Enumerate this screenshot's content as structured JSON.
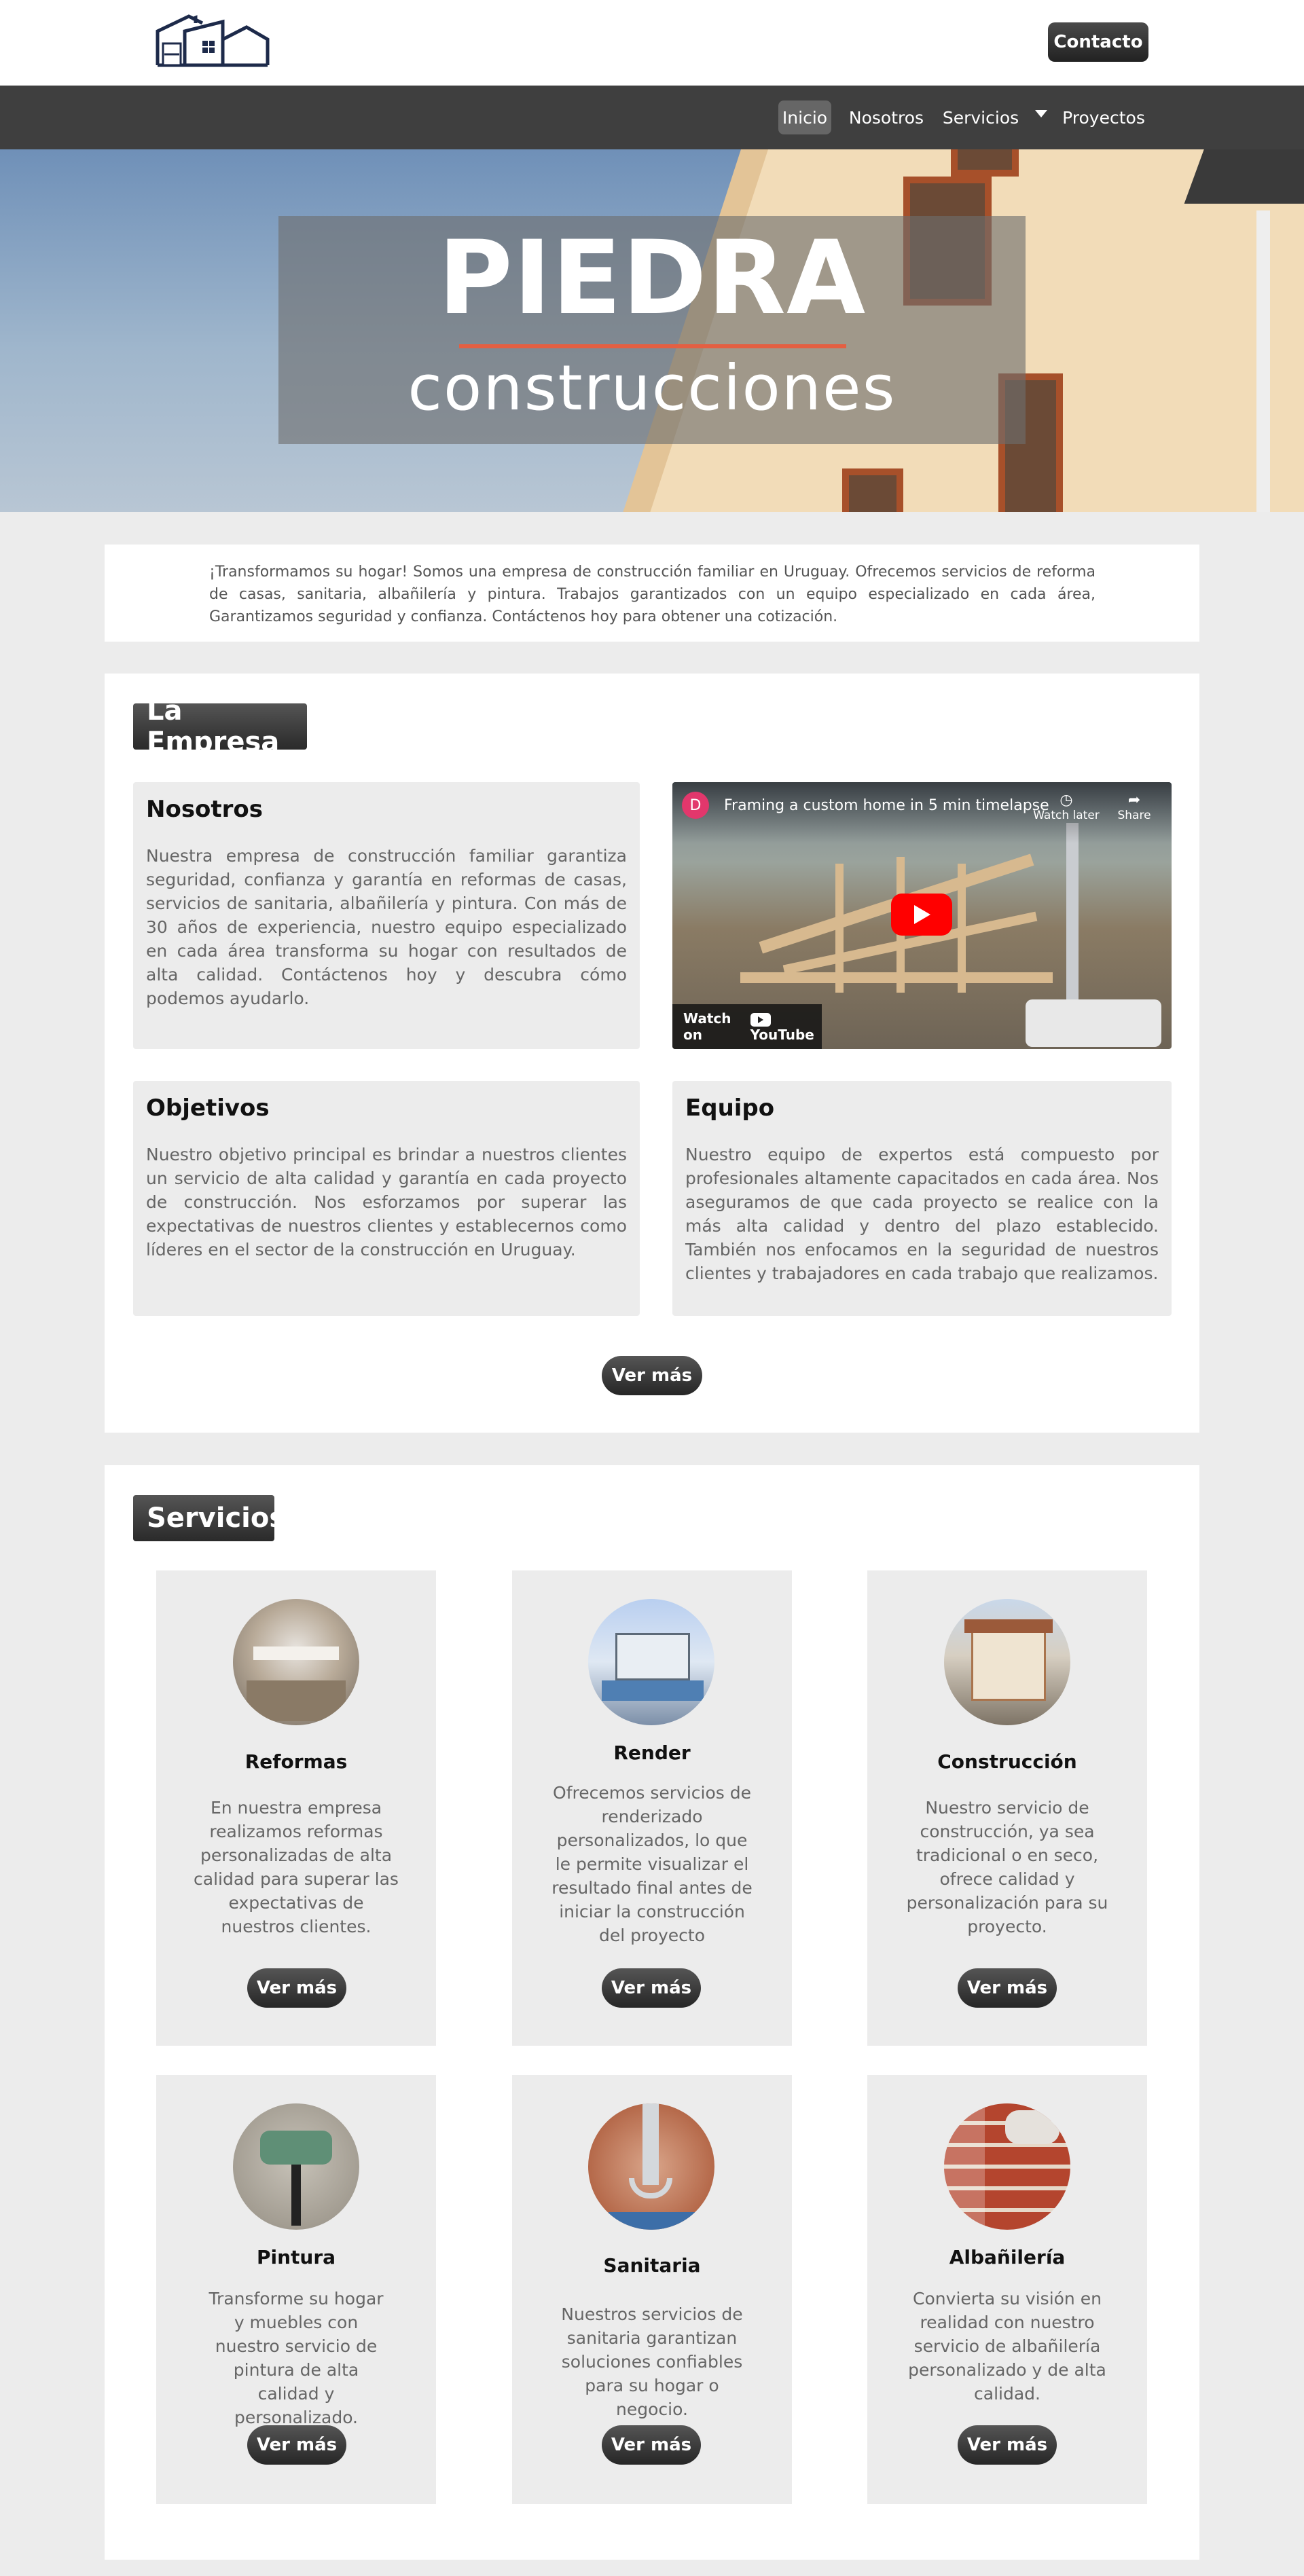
{
  "header": {
    "contact_label": "Contacto"
  },
  "nav": {
    "items": [
      "Inicio",
      "Nosotros",
      "Servicios",
      "Proyectos"
    ]
  },
  "hero": {
    "title": "PIEDRA",
    "subtitle": "construcciones"
  },
  "intro": {
    "text": "¡Transformamos su hogar! Somos una empresa de construcción familiar en Uruguay. Ofrecemos servicios de reforma de casas, sanitaria, albañilería y pintura. Trabajos garantizados con un equipo especializado en cada área, Garantizamos seguridad y confianza. Contáctenos hoy para obtener una cotización."
  },
  "empresa": {
    "heading": "La Empresa",
    "nosotros": {
      "title": "Nosotros",
      "text": "Nuestra empresa de construcción familiar garantiza seguridad, confianza y garantía en reformas de casas, servicios de sanitaria, albañilería y pintura. Con más de 30 años de experiencia, nuestro equipo especializado en cada área transforma su hogar con resultados de alta calidad. Contáctenos hoy y descubra cómo podemos ayudarlo."
    },
    "objetivos": {
      "title": "Objetivos",
      "text": "Nuestro objetivo principal es brindar a nuestros clientes un servicio de alta calidad y garantía en cada proyecto de construcción. Nos esforzamos por superar las expectativas de nuestros clientes y establecernos como líderes en el sector de la construcción en Uruguay."
    },
    "equipo": {
      "title": "Equipo",
      "text": "Nuestro equipo de expertos está compuesto por profesionales altamente capacitados en cada área. Nos aseguramos de que cada proyecto se realice con la más alta calidad y dentro del plazo establecido. También nos enfocamos en la seguridad de nuestros clientes y trabajadores en cada trabajo que realizamos."
    },
    "video": {
      "avatar": "D",
      "title": "Framing a custom home in 5 min timelapse",
      "watch_later": "Watch later",
      "share": "Share",
      "watch_on": "Watch on",
      "youtube": "YouTube"
    },
    "more_label": "Ver más"
  },
  "servicios": {
    "heading": "Servicios",
    "more_label": "Ver más",
    "items": [
      {
        "title": "Reformas",
        "text": "En nuestra empresa realizamos reformas personalizadas de alta calidad para superar las expectativas de nuestros clientes."
      },
      {
        "title": "Render",
        "text": "Ofrecemos servicios de renderizado personalizados, lo que le permite visualizar el resultado final antes de iniciar la construcción del proyecto"
      },
      {
        "title": "Construcción",
        "text": "Nuestro servicio de construcción, ya sea tradicional o en seco, ofrece calidad y personalización para su proyecto."
      },
      {
        "title": "Pintura",
        "text": "Transforme su hogar y muebles con nuestro servicio de pintura de alta calidad y personalizado."
      },
      {
        "title": "Sanitaria",
        "text": "Nuestros servicios de sanitaria garantizan soluciones confiables para su hogar o negocio."
      },
      {
        "title": "Albañilería",
        "text": "Convierta su visión en realidad con nuestro servicio de albañilería personalizado y de alta calidad."
      }
    ]
  }
}
